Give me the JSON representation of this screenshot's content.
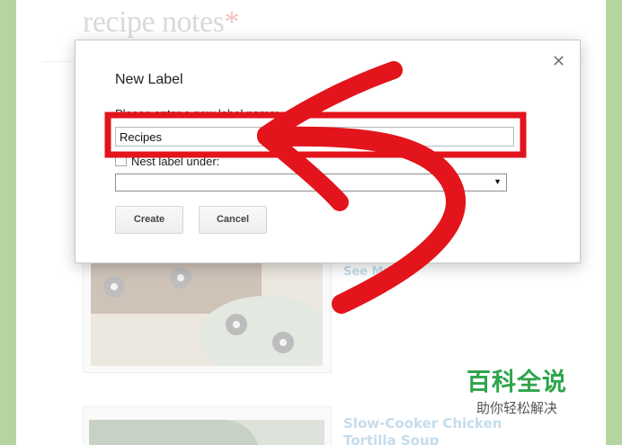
{
  "site": {
    "title": "recipe notes",
    "asterisk": "*"
  },
  "background": {
    "card1_link": "See Made",
    "card2_title": "Slow-Cooker Chicken Tortilla Soup"
  },
  "dialog": {
    "title": "New Label",
    "prompt": "Please enter a new label name:",
    "input_value": "Recipes",
    "nest_label": "Nest label under:",
    "nest_checked": false,
    "select_value": "",
    "create_label": "Create",
    "cancel_label": "Cancel",
    "close_icon": "close-icon"
  },
  "annotation": {
    "highlight_color": "#e3141b",
    "arrow_color": "#e3141b"
  },
  "watermark": {
    "brand": "百科全说",
    "tagline": "助你轻松解决"
  },
  "colors": {
    "frame": "#b6d4a0",
    "brand_green": "#2ea54b"
  }
}
